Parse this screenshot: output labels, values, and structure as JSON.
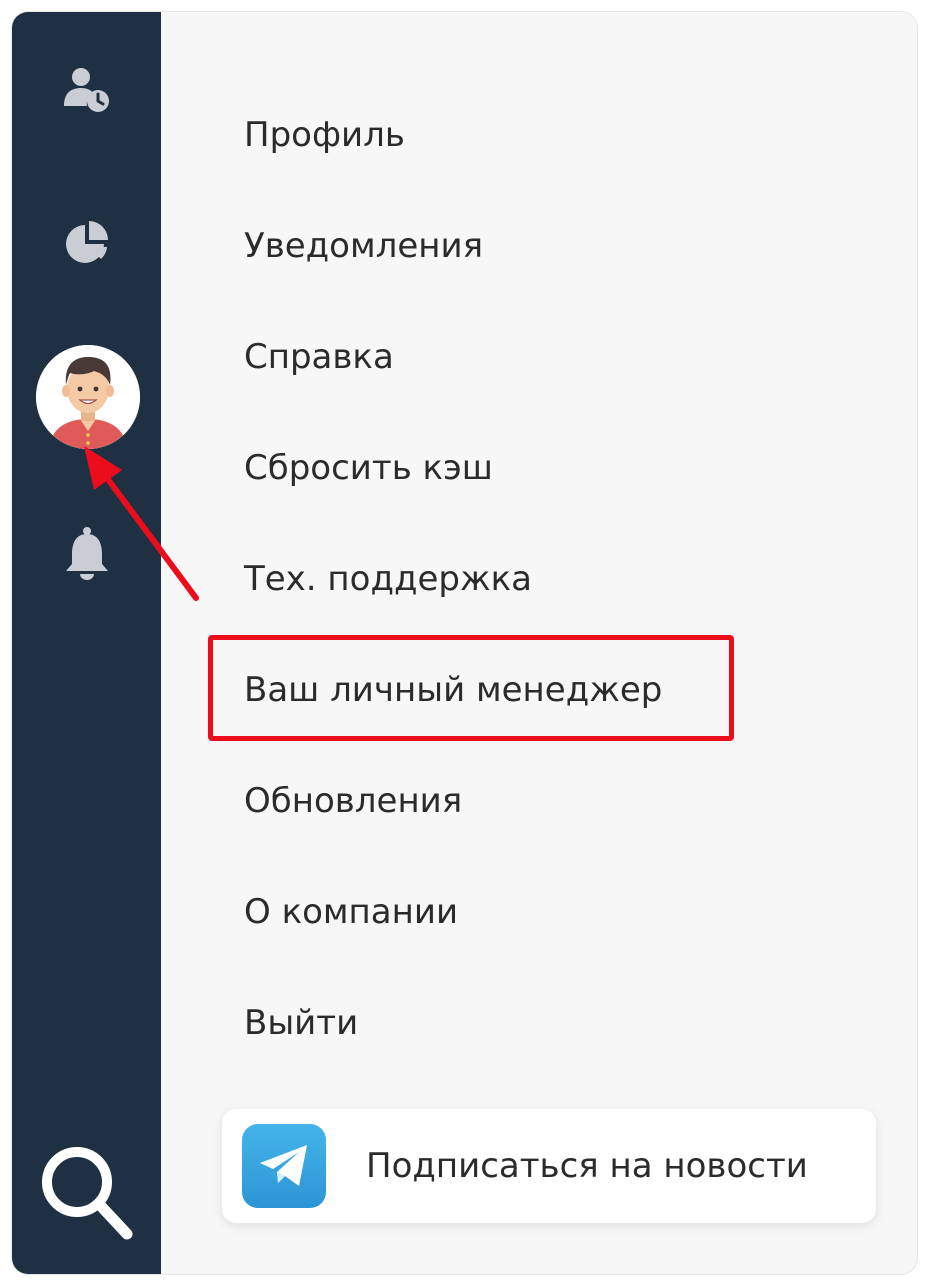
{
  "sidebar": {
    "icons": [
      "user-clock-icon",
      "pie-chart-icon",
      "avatar",
      "bell-icon",
      "search-icon"
    ],
    "colors": {
      "background": "#1e3042",
      "icon": "#c9ced6",
      "search": "#ffffff"
    }
  },
  "menu": {
    "items": [
      {
        "label": "Профиль"
      },
      {
        "label": "Уведомления"
      },
      {
        "label": "Справка"
      },
      {
        "label": "Сбросить кэш"
      },
      {
        "label": "Тех. поддержка"
      },
      {
        "label": "Ваш личный менеджер",
        "highlighted": true
      },
      {
        "label": "Обновления"
      },
      {
        "label": "О компании"
      },
      {
        "label": "Выйти"
      }
    ]
  },
  "subscribe": {
    "label": "Подписаться на новости",
    "icon": "telegram-icon"
  },
  "annotation": {
    "highlight_color": "#ec0d1c",
    "arrow_color": "#ec0d1c"
  }
}
